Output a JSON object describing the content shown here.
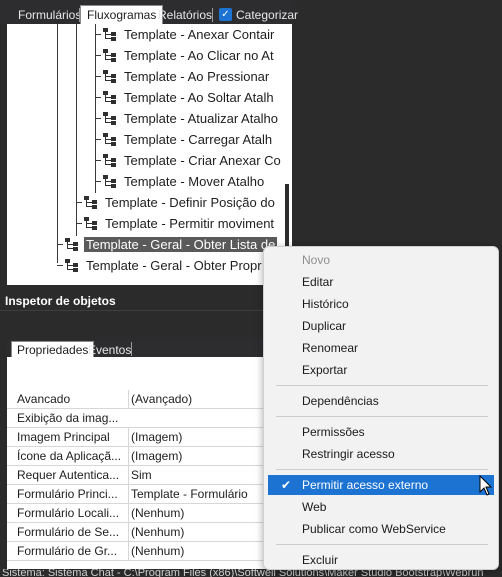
{
  "tabs": {
    "formularios": "Formulários",
    "fluxogramas": "Fluxogramas",
    "relatorios": "Relatórios",
    "categorizar": "Categorizar"
  },
  "tree": {
    "items": [
      {
        "label": "Template - Anexar Contair"
      },
      {
        "label": "Template - Ao Clicar no At"
      },
      {
        "label": "Template - Ao Pressionar"
      },
      {
        "label": "Template - Ao Soltar Atalh"
      },
      {
        "label": "Template - Atualizar Atalho"
      },
      {
        "label": "Template - Carregar Atalh"
      },
      {
        "label": "Template - Criar Anexar Co"
      },
      {
        "label": "Template - Mover Atalho"
      },
      {
        "label": "Template - Definir Posição do"
      },
      {
        "label": "Template - Permitir moviment"
      },
      {
        "label": "Template - Geral - Obter Lista de"
      },
      {
        "label": "Template - Geral - Obter Propr"
      }
    ]
  },
  "inspector": {
    "title": "Inspetor de objetos",
    "tab_properties": "Propriedades",
    "tab_events": "Eventos",
    "rows": [
      {
        "name": "Avancado",
        "value": "(Avançado)"
      },
      {
        "name": "Exibição da imag...",
        "value": ""
      },
      {
        "name": "Imagem Principal",
        "value": "(Imagem)"
      },
      {
        "name": "Ícone da Aplicaçã...",
        "value": "(Imagem)"
      },
      {
        "name": "Requer Autentica...",
        "value": "Sim"
      },
      {
        "name": "Formulário Princi...",
        "value": "Template - Formulário"
      },
      {
        "name": "Formulário Locali...",
        "value": "(Nenhum)"
      },
      {
        "name": "Formulário de Se...",
        "value": "(Nenhum)"
      },
      {
        "name": "Formulário de Gr...",
        "value": "(Nenhum)"
      }
    ]
  },
  "context_menu": {
    "novo": "Novo",
    "editar": "Editar",
    "historico": "Histórico",
    "duplicar": "Duplicar",
    "renomear": "Renomear",
    "exportar": "Exportar",
    "dependencias": "Dependências",
    "permissoes": "Permissões",
    "restringir": "Restringir acesso",
    "permitir_externo": "Permitir acesso externo",
    "web": "Web",
    "publicar": "Publicar como WebService",
    "excluir": "Excluir"
  },
  "status": {
    "text": "Sistema: Sistema Chat - C:\\Program Files (x86)\\Softwell Solutions\\Maker Studio Bootstrap\\Webrun"
  },
  "colors": {
    "accent": "#1c73d2",
    "panel_bg": "#2b2b2b",
    "selection": "#5a5a5a"
  }
}
